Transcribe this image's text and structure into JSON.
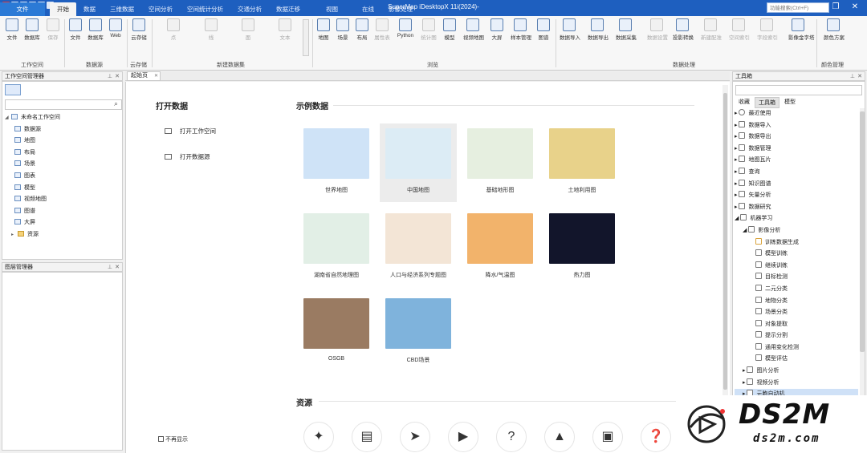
{
  "window": {
    "title": "SuperMap iDesktopX 11i(2024)-",
    "search_placeholder": "功能搜索(Ctrl+F)",
    "minimize": "—",
    "restore": "❐",
    "close": "✕"
  },
  "menu_tabs": [
    {
      "label": "文件"
    },
    {
      "label": "开始"
    },
    {
      "label": "数据"
    },
    {
      "label": "三维数据"
    },
    {
      "label": "空间分析"
    },
    {
      "label": "空间统计分析"
    },
    {
      "label": "交通分析"
    },
    {
      "label": "数据迁移"
    },
    {
      "label": "视图"
    },
    {
      "label": "在线"
    },
    {
      "label": "影像处理"
    }
  ],
  "ribbon": {
    "buttons": [
      {
        "label": "文件",
        "icon": "file-icon"
      },
      {
        "label": "数据库",
        "icon": "database-icon"
      },
      {
        "label": "保存",
        "icon": "save-icon"
      },
      {
        "label": "文件",
        "icon": "file-datasource-icon"
      },
      {
        "label": "数据库",
        "icon": "database-datasource-icon"
      },
      {
        "label": "Web",
        "icon": "web-icon"
      },
      {
        "label": "云存储",
        "icon": "cloud-storage-icon"
      },
      {
        "label": "点",
        "icon": "point-icon"
      },
      {
        "label": "线",
        "icon": "line-icon"
      },
      {
        "label": "面",
        "icon": "polygon-icon"
      },
      {
        "label": "文本",
        "icon": "text-icon"
      },
      {
        "label": "地图",
        "icon": "map-icon"
      },
      {
        "label": "场景",
        "icon": "scene-icon"
      },
      {
        "label": "布局",
        "icon": "layout-icon"
      },
      {
        "label": "属性表",
        "icon": "attribute-table-icon"
      },
      {
        "label": "Python",
        "icon": "python-icon"
      },
      {
        "label": "统计图",
        "icon": "chart-icon"
      },
      {
        "label": "模型",
        "icon": "model-icon"
      },
      {
        "label": "视频地图",
        "icon": "video-map-icon"
      },
      {
        "label": "大屏",
        "icon": "big-screen-icon"
      },
      {
        "label": "样本管理",
        "icon": "sample-manager-icon"
      },
      {
        "label": "图谱",
        "icon": "graph-icon"
      },
      {
        "label": "数据导入",
        "icon": "data-import-icon"
      },
      {
        "label": "数据导出",
        "icon": "data-export-icon"
      },
      {
        "label": "数据采集",
        "icon": "data-collect-icon"
      },
      {
        "label": "数据设置",
        "icon": "data-settings-icon"
      },
      {
        "label": "投影转换",
        "icon": "projection-icon"
      },
      {
        "label": "新建配准",
        "icon": "new-registration-icon"
      },
      {
        "label": "空间索引",
        "icon": "spatial-index-icon"
      },
      {
        "label": "字段索引",
        "icon": "field-index-icon"
      },
      {
        "label": "影像金字塔",
        "icon": "image-pyramid-icon"
      },
      {
        "label": "颜色方案",
        "icon": "color-scheme-icon"
      }
    ],
    "groups": [
      {
        "label": "工作空间"
      },
      {
        "label": "数据源"
      },
      {
        "label": "云存储"
      },
      {
        "label": "新建数据集"
      },
      {
        "label": "浏览"
      },
      {
        "label": "数据处理"
      },
      {
        "label": "颜色管理"
      }
    ]
  },
  "workspace_panel": {
    "title": "工作空间管理器",
    "root": "未命名工作空间",
    "items": [
      {
        "label": "数据源"
      },
      {
        "label": "地图"
      },
      {
        "label": "布局"
      },
      {
        "label": "场景"
      },
      {
        "label": "图表"
      },
      {
        "label": "模型"
      },
      {
        "label": "视频地图"
      },
      {
        "label": "图谱"
      },
      {
        "label": "大屏"
      },
      {
        "label": "资源"
      }
    ]
  },
  "layer_panel": {
    "title": "图层管理器"
  },
  "document_tab": {
    "label": "起始页"
  },
  "start_page": {
    "open_data_title": "打开数据",
    "open_workspace": "打开工作空间",
    "open_datasource": "打开数据源",
    "sample_title": "示例数据",
    "samples": [
      {
        "label": "世界地图",
        "color": "#cfe3f7"
      },
      {
        "label": "中国地图",
        "color": "#dcecf5"
      },
      {
        "label": "基础地形图",
        "color": "#e6efe0"
      },
      {
        "label": "土地利用图",
        "color": "#e8d28a"
      },
      {
        "label": "湖南省自然地理图",
        "color": "#e2efe6"
      },
      {
        "label": "人口与经济系列专题图",
        "color": "#f3e5d6"
      },
      {
        "label": "降水/气温图",
        "color": "#f2b36b"
      },
      {
        "label": "热力图",
        "color": "#12152b"
      },
      {
        "label": "OSGB",
        "color": "#9a7b62"
      },
      {
        "label": "CBD场景",
        "color": "#7fb3dc"
      }
    ],
    "resources_title": "资源",
    "dont_show_again": "不再显示"
  },
  "toolbox": {
    "title": "工具箱",
    "tabs": [
      {
        "label": "收藏"
      },
      {
        "label": "工具箱"
      },
      {
        "label": "模型"
      }
    ],
    "items": [
      {
        "label": "最近使用",
        "level": 0,
        "expanded": false
      },
      {
        "label": "数据导入",
        "level": 0,
        "expanded": false
      },
      {
        "label": "数据导出",
        "level": 0,
        "expanded": false
      },
      {
        "label": "数据管理",
        "level": 0,
        "expanded": false
      },
      {
        "label": "地图瓦片",
        "level": 0,
        "expanded": false
      },
      {
        "label": "查询",
        "level": 0,
        "expanded": false
      },
      {
        "label": "知识图谱",
        "level": 0,
        "expanded": false
      },
      {
        "label": "矢量分析",
        "level": 0,
        "expanded": false
      },
      {
        "label": "数据研究",
        "level": 0,
        "expanded": false
      },
      {
        "label": "机器学习",
        "level": 0,
        "expanded": true
      },
      {
        "label": "影像分析",
        "level": 1,
        "expanded": true
      },
      {
        "label": "训练数据生成",
        "level": 2,
        "expanded": false
      },
      {
        "label": "模型训练",
        "level": 2,
        "expanded": false
      },
      {
        "label": "继续训练",
        "level": 2,
        "expanded": false
      },
      {
        "label": "目标检测",
        "level": 2,
        "expanded": false
      },
      {
        "label": "二元分类",
        "level": 2,
        "expanded": false
      },
      {
        "label": "地物分类",
        "level": 2,
        "expanded": false
      },
      {
        "label": "场景分类",
        "level": 2,
        "expanded": false
      },
      {
        "label": "对象提取",
        "level": 2,
        "expanded": false
      },
      {
        "label": "提示分割",
        "level": 2,
        "expanded": false
      },
      {
        "label": "通用变化检测",
        "level": 2,
        "expanded": false
      },
      {
        "label": "模型评估",
        "level": 2,
        "expanded": false
      },
      {
        "label": "图片分析",
        "level": 1,
        "expanded": false
      },
      {
        "label": "视频分析",
        "level": 1,
        "expanded": false
      },
      {
        "label": "元胞自动机",
        "level": 1,
        "expanded": false
      }
    ]
  },
  "watermark": {
    "brand": "DS2M",
    "domain": "ds2m.com"
  },
  "colors": {
    "title_bar": "#1e5fbf",
    "accent": "#3a7bd5"
  }
}
